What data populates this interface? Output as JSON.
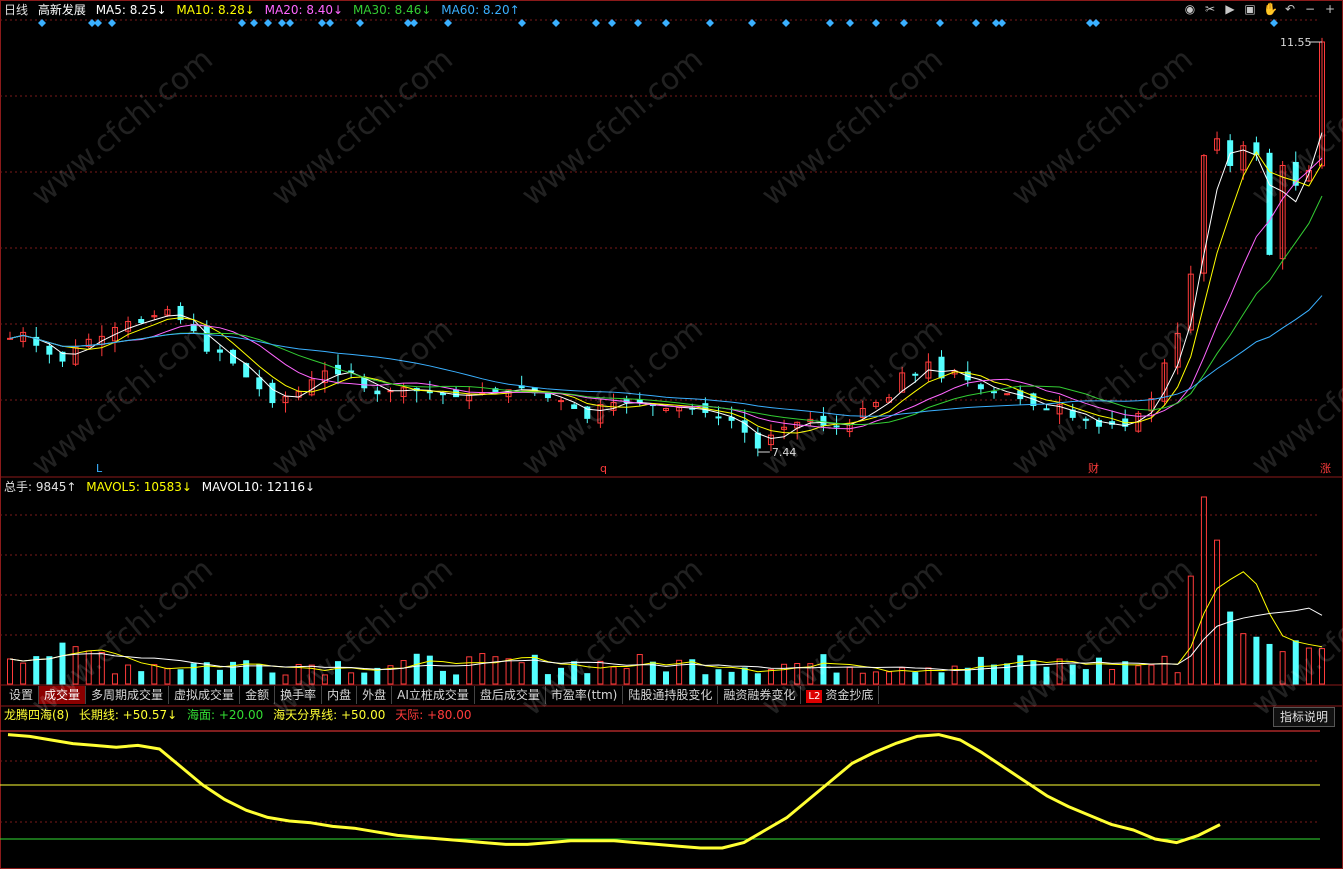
{
  "header": {
    "period": "日线",
    "stock_name": "高新发展",
    "ma5": "MA5: 8.25↓",
    "ma10": "MA10: 8.28↓",
    "ma20": "MA20: 8.40↓",
    "ma30": "MA30: 8.46↓",
    "ma60": "MA60: 8.20↑"
  },
  "volume_header": {
    "total": "总手: 9845↑",
    "mavol5": "MAVOL5: 10583↓",
    "mavol10": "MAVOL10: 12116↓"
  },
  "indicator_header": {
    "name": "龙腾四海(8)",
    "long_line": "长期线: +50.57↓",
    "sea": "海面: +20.00",
    "boundary": "海天分界线: +50.00",
    "sky": "天际: +80.00"
  },
  "tabs": [
    "设置",
    "成交量",
    "多周期成交量",
    "虚拟成交量",
    "金额",
    "换手率",
    "内盘",
    "外盘",
    "AI立桩成交量",
    "盘后成交量",
    "市盈率(ttm)",
    "陆股通持股变化",
    "融资融券变化",
    "资金抄底"
  ],
  "active_tab": "成交量",
  "l2_badge": "L2",
  "explain_button": "指标说明",
  "price_labels": {
    "high": "11.55",
    "low": "7.44"
  },
  "event_markers": [
    "L",
    "q",
    "财",
    "涨"
  ],
  "watermark": "www.cfchi.com",
  "colors": {
    "up": "#ff3b3b",
    "down": "#54ffff",
    "ma5": "#ffffff",
    "ma10": "#ffff00",
    "ma20": "#ff66ff",
    "ma30": "#33cc33",
    "ma60": "#3ab0ff",
    "indicator": "#ffff33",
    "grid": "#7a1a1a",
    "diamond": "#3ab0ff"
  },
  "chart_data": {
    "type": "candlestick",
    "close_prices": [
      8.55,
      8.61,
      8.48,
      8.39,
      8.32,
      8.46,
      8.54,
      8.57,
      8.66,
      8.72,
      8.71,
      8.78,
      8.84,
      8.74,
      8.63,
      8.42,
      8.41,
      8.3,
      8.16,
      8.04,
      7.9,
      7.96,
      8.01,
      8.13,
      8.22,
      8.19,
      8.21,
      8.05,
      7.99,
      8.02,
      8.05,
      8.02,
      8.0,
      7.98,
      7.96,
      7.98,
      8.0,
      8.01,
      8.03,
      8.05,
      8.0,
      7.95,
      7.92,
      7.84,
      7.74,
      7.88,
      7.9,
      7.9,
      7.9,
      7.87,
      7.84,
      7.85,
      7.84,
      7.8,
      7.75,
      7.72,
      7.6,
      7.44,
      7.57,
      7.65,
      7.7,
      7.73,
      7.67,
      7.66,
      7.69,
      7.84,
      7.9,
      7.95,
      8.2,
      8.18,
      8.31,
      8.15,
      8.22,
      8.13,
      8.04,
      8.0,
      7.99,
      7.94,
      7.87,
      7.83,
      7.88,
      7.75,
      7.72,
      7.66,
      7.68,
      7.66,
      7.79,
      7.94,
      8.3,
      8.6,
      9.2,
      10.4,
      10.57,
      10.3,
      10.5,
      10.41,
      9.4,
      10.3,
      10.1,
      10.25,
      11.55
    ],
    "high": 11.55,
    "low": 7.44,
    "moving_averages": [
      "MA5",
      "MA10",
      "MA20",
      "MA30",
      "MA60"
    ],
    "volume": {
      "current": 9845,
      "mavol5": 10583,
      "mavol10": 12116
    },
    "indicator": {
      "name": "龙腾四海(8)",
      "levels": {
        "sky": 80,
        "boundary": 50,
        "sea": 20
      },
      "values": [
        78,
        77,
        75,
        73,
        72,
        71,
        72,
        70,
        60,
        50,
        42,
        36,
        32,
        30,
        29,
        27,
        26,
        24,
        22,
        21,
        20,
        19,
        18,
        17,
        17,
        18,
        19,
        19,
        19,
        18,
        17,
        16,
        15,
        15,
        18,
        25,
        32,
        42,
        52,
        62,
        68,
        73,
        77,
        78,
        75,
        68,
        60,
        52,
        44,
        38,
        33,
        28,
        25,
        20,
        18,
        22,
        28
      ]
    }
  }
}
